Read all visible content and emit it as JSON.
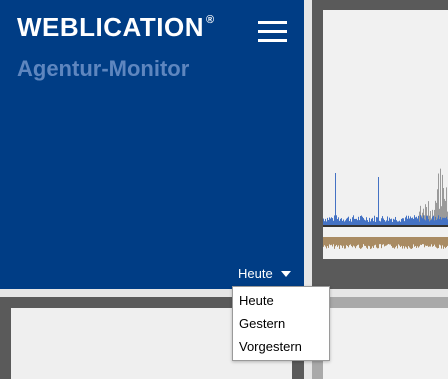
{
  "header": {
    "brand": "WEBLICATION",
    "brand_mark": "®",
    "subtitle": "Agentur-Monitor"
  },
  "period_select": {
    "selected": "Heute",
    "options": [
      "Heute",
      "Gestern",
      "Vorgestern"
    ]
  },
  "colors": {
    "panel_blue": "#003d85",
    "subtitle": "#5e86bf",
    "chart_blue": "#4472c4",
    "chart_gray": "#9a9a9a",
    "chart_brown": "#a98b63"
  },
  "icons": [
    "hamburger-menu-icon",
    "caret-down-icon"
  ]
}
